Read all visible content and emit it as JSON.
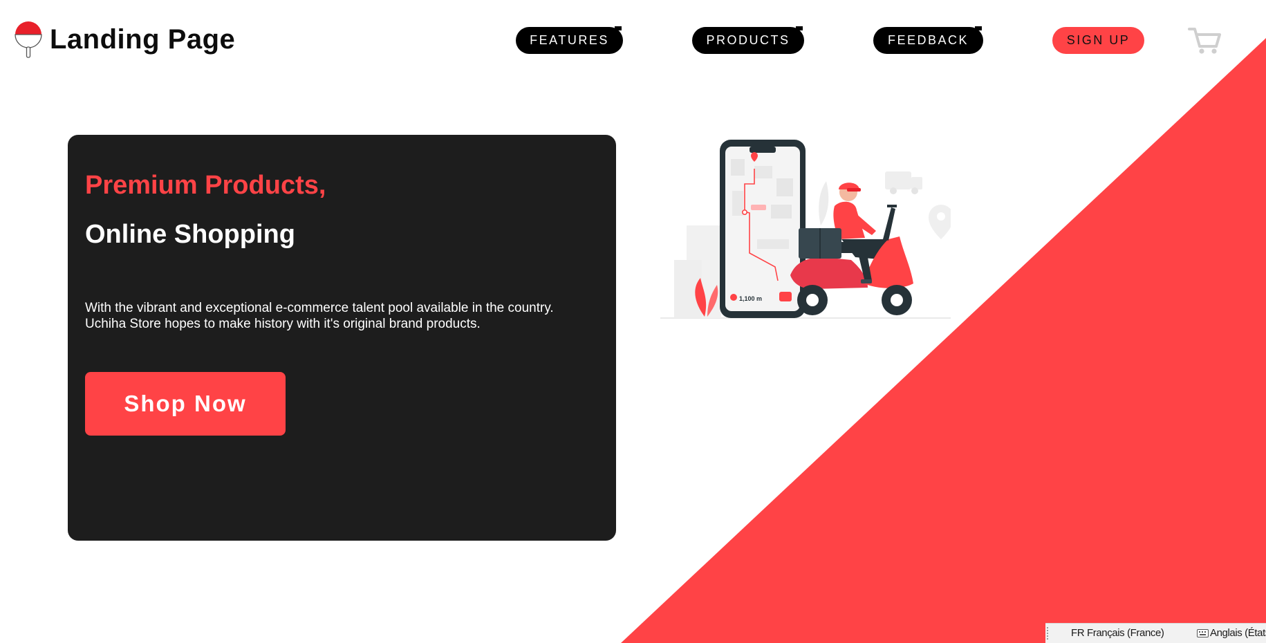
{
  "header": {
    "logo_title": "Landing Page",
    "nav": {
      "features": "FEATURES",
      "products": "PRODUCTS",
      "feedback": "FEEDBACK",
      "signup": "SIGN UP"
    },
    "cart_icon": "shopping-cart-icon"
  },
  "hero": {
    "kicker": "Premium Products,",
    "title": "Online Shopping",
    "description_line1": "With the vibrant and exceptional e-commerce talent pool available in the country.",
    "description_line2": "Uchiha Store hopes to make history with it's original brand products.",
    "cta": "Shop Now"
  },
  "illustration": {
    "distance": "1,100 m"
  },
  "language_bar": {
    "input_language": "FR Français (France)",
    "keyboard": "Anglais (États"
  },
  "colors": {
    "accent": "#ff4346",
    "card": "#1d1d1d",
    "nav": "#000000"
  }
}
